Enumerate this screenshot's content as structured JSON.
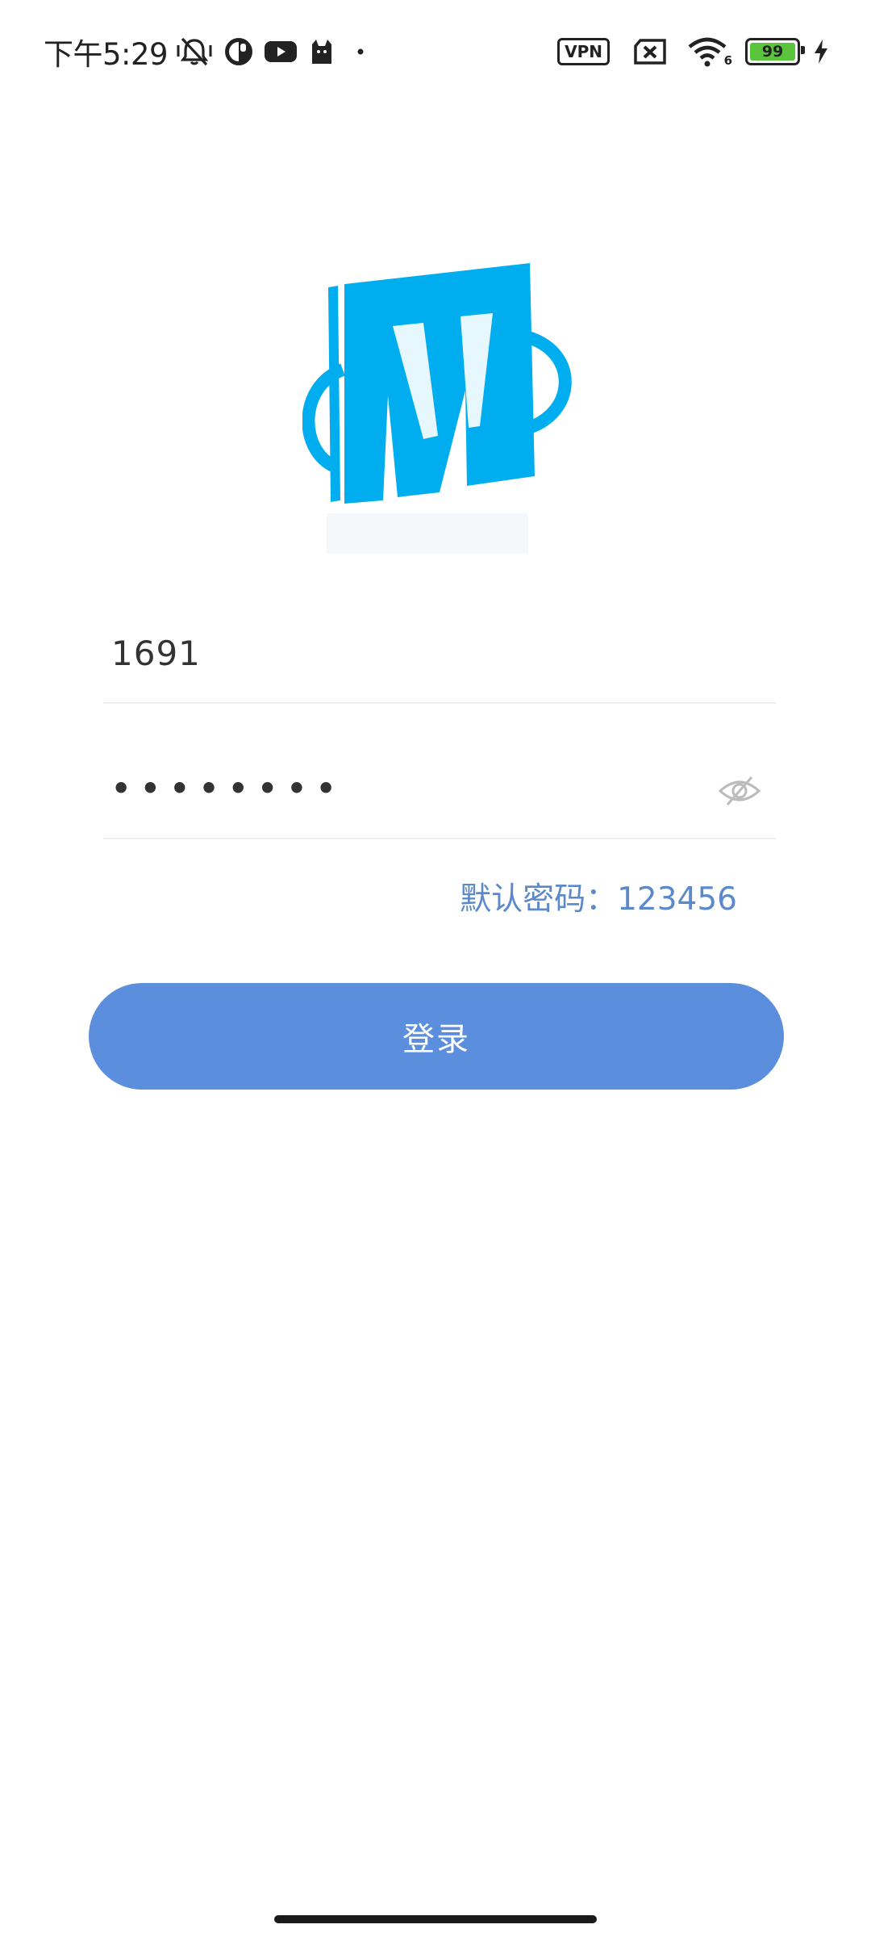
{
  "status_bar": {
    "time": "下午5:29",
    "left_icons": [
      "mute-vibrate-icon",
      "pie-app-icon",
      "youtube-icon",
      "cat-app-icon",
      "dot-icon"
    ],
    "vpn_label": "VPN",
    "right_icons": [
      "sim-x-icon",
      "wifi-icon",
      "battery-icon",
      "charging-icon"
    ],
    "wifi_badge": "6",
    "battery_level": "99"
  },
  "logo": {
    "description_icon": "m-logo-icon",
    "color": "#00aeef"
  },
  "login_form": {
    "username_value": "1691",
    "password_masked": "••••••••",
    "default_password_hint": "默认密码：123456",
    "login_label": "登录"
  },
  "colors": {
    "accent": "#5c8ede",
    "hint_text": "#5b89c9",
    "logo_blue": "#00aeef"
  }
}
